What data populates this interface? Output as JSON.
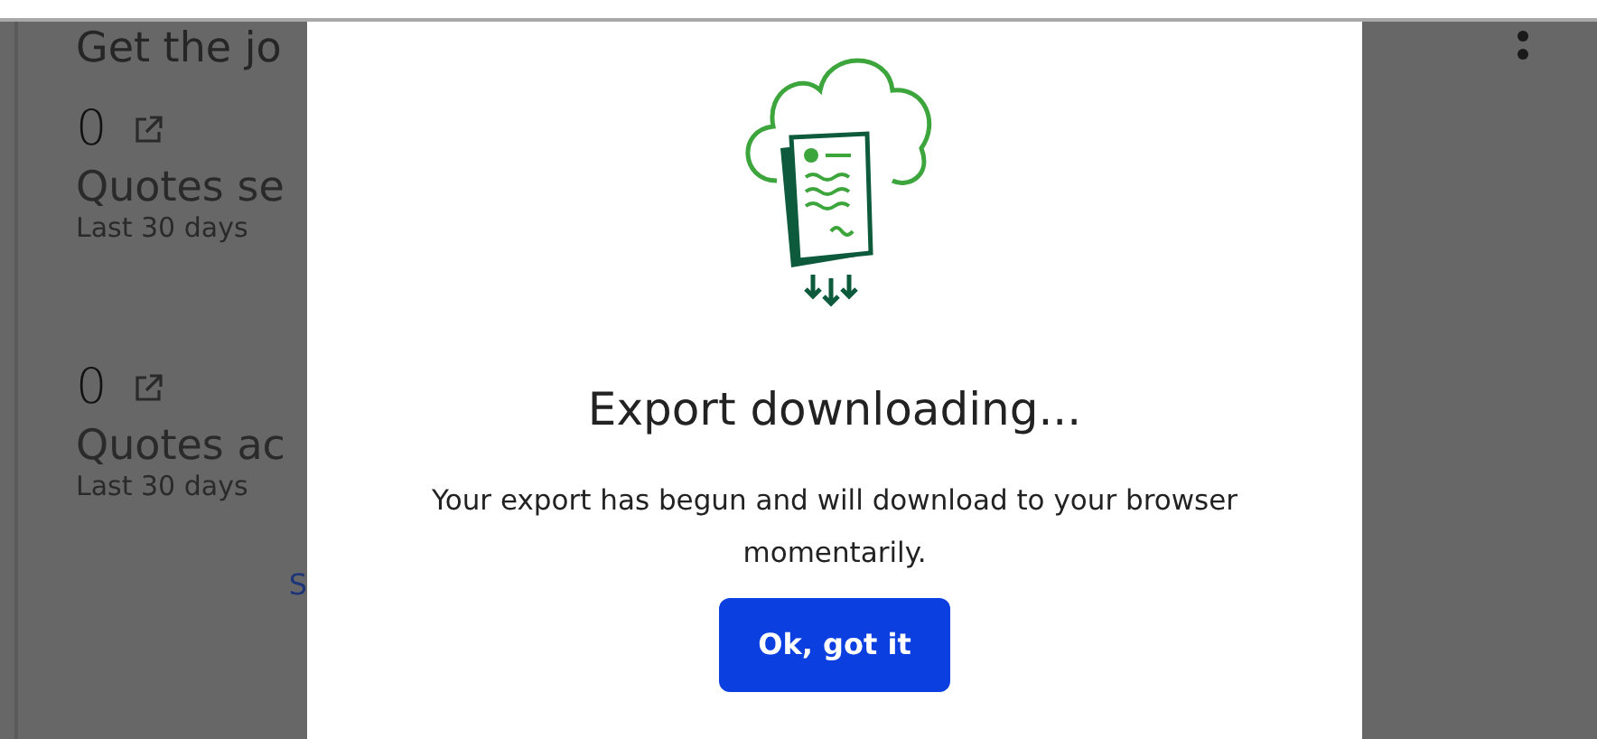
{
  "background": {
    "heading": "Get the jo",
    "stats": [
      {
        "value": "0",
        "label": "Quotes se",
        "period": "Last 30 days"
      },
      {
        "value": "0",
        "label": "Quotes ac",
        "period": "Last 30 days"
      }
    ],
    "link": "S"
  },
  "modal": {
    "title": "Export downloading...",
    "message": "Your export has begun and will download to your browser momentarily.",
    "button": "Ok, got it"
  }
}
